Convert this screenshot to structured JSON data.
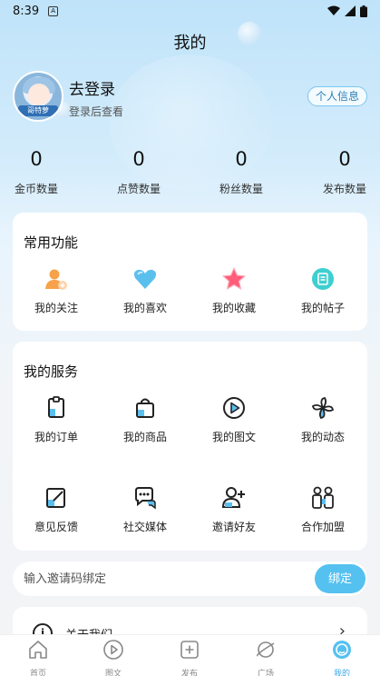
{
  "status_bar": {
    "time": "8:39",
    "notif_glyph": "A"
  },
  "page": {
    "title": "我的"
  },
  "profile": {
    "login_title": "去登录",
    "login_subtitle": "登录后查看",
    "avatar_caption": "哥特萝",
    "personal_info_label": "个人信息"
  },
  "stats": [
    {
      "value": "0",
      "label": "金币数量"
    },
    {
      "value": "0",
      "label": "点赞数量"
    },
    {
      "value": "0",
      "label": "粉丝数量"
    },
    {
      "value": "0",
      "label": "发布数量"
    }
  ],
  "common_functions": {
    "title": "常用功能",
    "items": [
      {
        "label": "我的关注",
        "icon": "follow-user-icon"
      },
      {
        "label": "我的喜欢",
        "icon": "heart-icon"
      },
      {
        "label": "我的收藏",
        "icon": "star-icon"
      },
      {
        "label": "我的帖子",
        "icon": "post-icon"
      }
    ]
  },
  "my_services": {
    "title": "我的服务",
    "items": [
      {
        "label": "我的订单",
        "icon": "order-icon"
      },
      {
        "label": "我的商品",
        "icon": "shopping-bag-icon"
      },
      {
        "label": "我的图文",
        "icon": "play-circle-icon"
      },
      {
        "label": "我的动态",
        "icon": "pinwheel-icon"
      },
      {
        "label": "意见反馈",
        "icon": "feedback-edit-icon"
      },
      {
        "label": "社交媒体",
        "icon": "chat-bubble-icon"
      },
      {
        "label": "邀请好友",
        "icon": "invite-friend-icon"
      },
      {
        "label": "合作加盟",
        "icon": "partnership-icon"
      }
    ]
  },
  "invite": {
    "placeholder": "输入邀请码绑定",
    "bind_label": "绑定"
  },
  "about": {
    "label": "关于我们"
  },
  "tabbar": {
    "items": [
      {
        "label": "首页",
        "icon": "home-icon"
      },
      {
        "label": "图文",
        "icon": "play-icon"
      },
      {
        "label": "发布",
        "icon": "add-square-icon"
      },
      {
        "label": "广场",
        "icon": "planet-icon"
      },
      {
        "label": "我的",
        "icon": "profile-icon"
      }
    ],
    "active_index": 4
  },
  "colors": {
    "accent": "#55c1f0",
    "accent_text": "#3aa8e6",
    "heart": "#5bbfee",
    "star": "#ff5d7a",
    "follow": "#f7a24a",
    "post": "#3fcfd0"
  }
}
